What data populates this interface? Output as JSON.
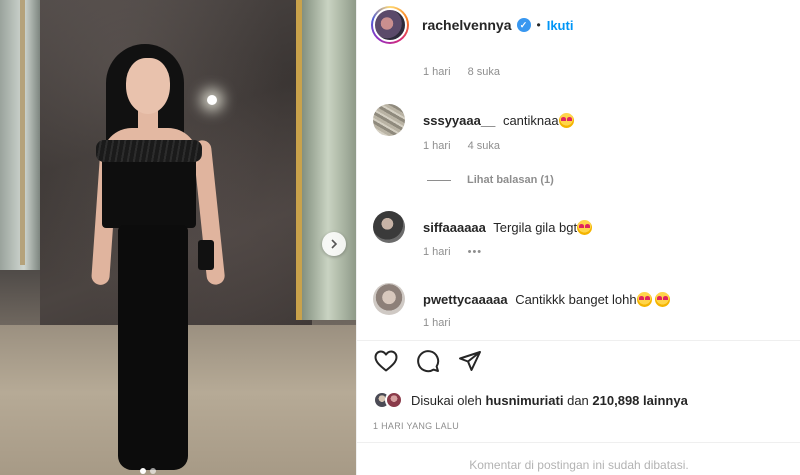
{
  "header": {
    "username": "rachelvennya",
    "separator": "•",
    "follow_label": "Ikuti"
  },
  "carousel": {
    "next_icon": "chevron-right-icon",
    "dots": 2,
    "active_dot": 0
  },
  "top_meta": {
    "time": "1 hari",
    "likes": "8 suka"
  },
  "comments": [
    {
      "username": "sssyyaaa__",
      "text": "cantiknaa",
      "emojis": 1,
      "time": "1 hari",
      "likes": "4 suka"
    },
    {
      "username": "siffaaaaaa",
      "text": "Tergila gila bgt",
      "emojis": 1,
      "time": "1 hari",
      "more": "•••"
    },
    {
      "username": "pwettycaaaaa",
      "text": "Cantikkk banget lohh",
      "emojis": 2,
      "time": "1 hari"
    }
  ],
  "replies": {
    "label": "Lihat balasan (1)"
  },
  "actions": {
    "like_icon": "heart-icon",
    "comment_icon": "comment-icon",
    "share_icon": "send-icon"
  },
  "likes": {
    "prefix": "Disukai oleh",
    "user": "husnimuriati",
    "middle": "dan",
    "count": "210,898 lainnya"
  },
  "date": "1 HARI YANG LALU",
  "comments_closed": "Komentar di postingan ini sudah dibatasi.",
  "colors": {
    "accent": "#0095f6",
    "verified": "#3897f0",
    "muted": "#8e8e8e"
  }
}
